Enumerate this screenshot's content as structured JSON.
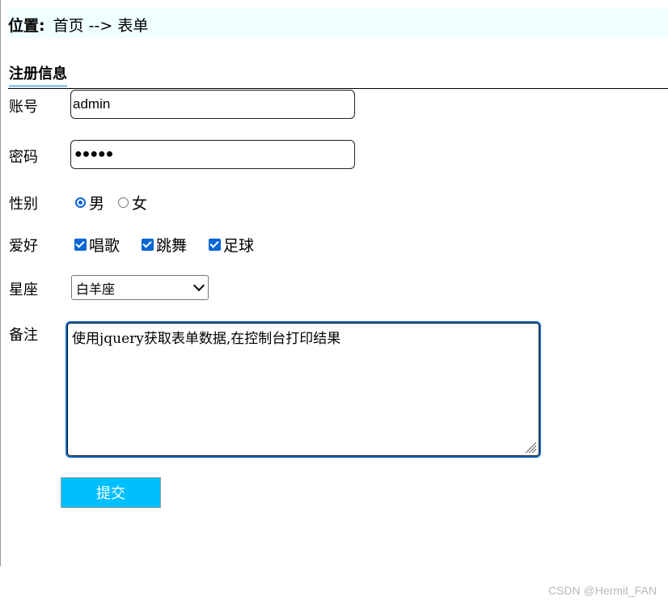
{
  "breadcrumb": {
    "label": "位置:",
    "path": "首页 --> 表单"
  },
  "section_title": "注册信息",
  "form": {
    "account": {
      "label": "账号",
      "value": "admin"
    },
    "password": {
      "label": "密码",
      "masked": "●●●●●"
    },
    "gender": {
      "label": "性别",
      "options": [
        {
          "text": "男",
          "checked": true
        },
        {
          "text": "女",
          "checked": false
        }
      ]
    },
    "hobbies": {
      "label": "爱好",
      "options": [
        {
          "text": "唱歌",
          "checked": true
        },
        {
          "text": "跳舞",
          "checked": true
        },
        {
          "text": "足球",
          "checked": true
        }
      ]
    },
    "constellation": {
      "label": "星座",
      "selected": "白羊座"
    },
    "remark": {
      "label": "备注",
      "value": "使用jquery获取表单数据,在控制台打印结果"
    },
    "submit_label": "提交"
  },
  "watermark": "CSDN @Hermit_FAN",
  "colors": {
    "accent": "#0a66d6",
    "submit_bg": "#00bfff",
    "breadcrumb_bg": "#f0ffff"
  }
}
